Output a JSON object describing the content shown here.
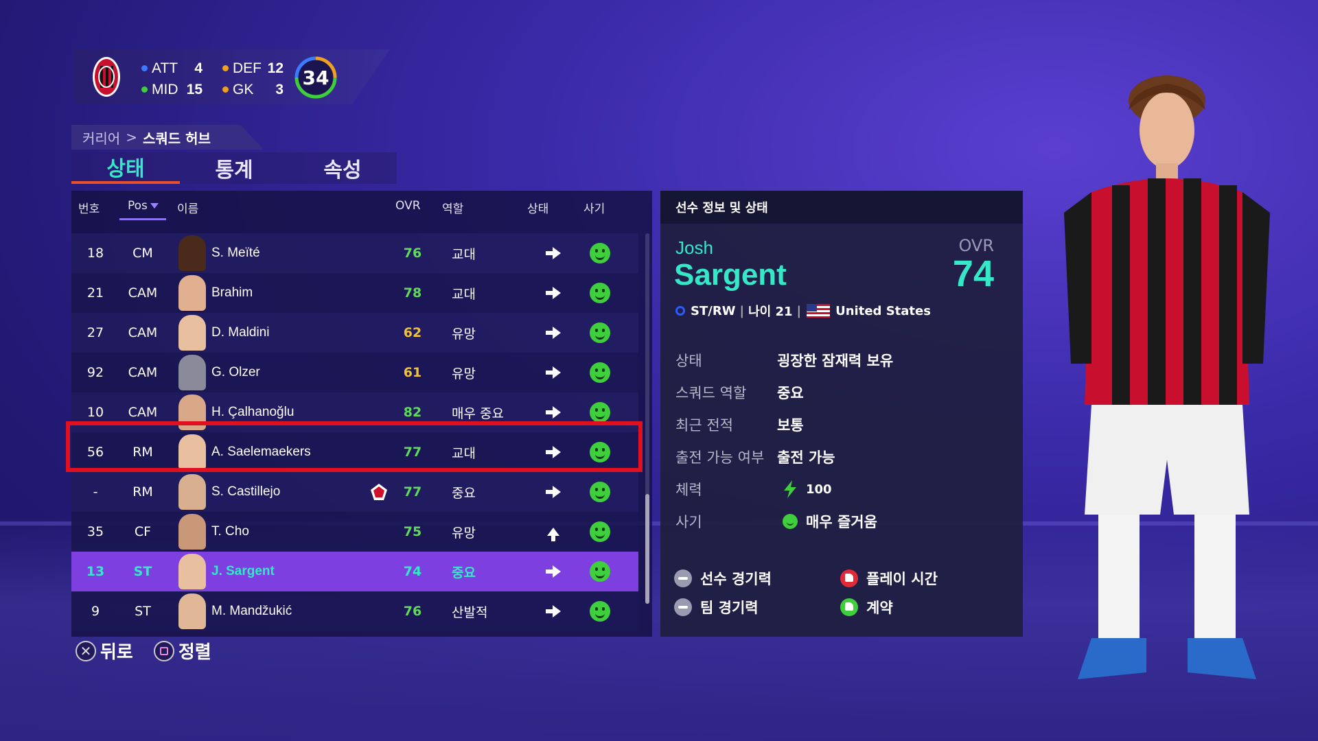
{
  "colors": {
    "accent": "#34e8c8",
    "selected_row": "#7d3fe0",
    "highlight": "#e0101e",
    "ovr_green": "#5fdc5a",
    "ovr_yellow": "#f0c23a"
  },
  "squad_summary": {
    "att_label": "ATT",
    "att_count": "4",
    "def_label": "DEF",
    "def_count": "12",
    "mid_label": "MID",
    "mid_count": "15",
    "gk_label": "GK",
    "gk_count": "3",
    "total": "34"
  },
  "breadcrumb": {
    "root": "커리어",
    "separator": ">",
    "current": "스쿼드 허브"
  },
  "tabs": [
    {
      "label": "상태",
      "active": true
    },
    {
      "label": "통계",
      "active": false
    },
    {
      "label": "속성",
      "active": false
    }
  ],
  "table": {
    "headers": {
      "number": "번호",
      "pos": "Pos",
      "name": "이름",
      "ovr": "OVR",
      "role": "역할",
      "status": "상태",
      "morale": "사기"
    },
    "rows": [
      {
        "number": "18",
        "pos": "CM",
        "name": "S. Meïté",
        "ovr": "76",
        "ovr_color": "green",
        "role": "교대",
        "status": "arrow-right-icon",
        "morale": "happy-face-icon"
      },
      {
        "number": "21",
        "pos": "CAM",
        "name": "Brahim",
        "ovr": "78",
        "ovr_color": "green",
        "role": "교대",
        "status": "arrow-right-icon",
        "morale": "happy-face-icon"
      },
      {
        "number": "27",
        "pos": "CAM",
        "name": "D. Maldini",
        "ovr": "62",
        "ovr_color": "yellow",
        "role": "유망",
        "status": "arrow-right-icon",
        "morale": "happy-face-icon"
      },
      {
        "number": "92",
        "pos": "CAM",
        "name": "G. Olzer",
        "ovr": "61",
        "ovr_color": "yellow",
        "role": "유망",
        "status": "arrow-right-icon",
        "morale": "happy-face-icon"
      },
      {
        "number": "10",
        "pos": "CAM",
        "name": "H. Çalhanoğlu",
        "ovr": "82",
        "ovr_color": "green",
        "role": "매우 중요",
        "status": "arrow-right-icon",
        "morale": "happy-face-icon"
      },
      {
        "number": "56",
        "pos": "RM",
        "name": "A. Saelemaekers",
        "ovr": "77",
        "ovr_color": "green",
        "role": "교대",
        "status": "arrow-right-icon",
        "morale": "happy-face-icon"
      },
      {
        "number": "-",
        "pos": "RM",
        "name": "S. Castillejo",
        "ovr": "77",
        "ovr_color": "green",
        "role": "중요",
        "status": "arrow-right-icon",
        "morale": "happy-face-icon",
        "loan_badge": "loan-club-badge-icon"
      },
      {
        "number": "35",
        "pos": "CF",
        "name": "T. Cho",
        "ovr": "75",
        "ovr_color": "green",
        "role": "유망",
        "status": "arrow-up-icon",
        "morale": "happy-face-icon"
      },
      {
        "number": "13",
        "pos": "ST",
        "name": "J. Sargent",
        "ovr": "74",
        "ovr_color": "green",
        "role": "중요",
        "status": "arrow-right-icon",
        "morale": "happy-face-icon",
        "selected": true
      },
      {
        "number": "9",
        "pos": "ST",
        "name": "M. Mandžukić",
        "ovr": "76",
        "ovr_color": "green",
        "role": "산발적",
        "status": "arrow-right-icon",
        "morale": "happy-face-icon"
      }
    ]
  },
  "hints": {
    "back_label": "뒤로",
    "sort_label": "정렬"
  },
  "player_info": {
    "header": "선수 정보 및 상태",
    "first_name": "Josh",
    "last_name": "Sargent",
    "ovr_label": "OVR",
    "ovr": "74",
    "positions": "ST/RW",
    "age": "나이 21",
    "nation": "United States",
    "details": [
      {
        "key": "상태",
        "value": "굉장한 잠재력 보유"
      },
      {
        "key": "스쿼드 역할",
        "value": "중요"
      },
      {
        "key": "최근 전적",
        "value": "보통"
      },
      {
        "key": "출전 가능 여부",
        "value": "출전 가능"
      },
      {
        "key": "체력",
        "value": "100"
      },
      {
        "key": "사기",
        "value": "매우 즐거움"
      }
    ],
    "factors": [
      {
        "label": "선수 경기력",
        "icon": "neutral-minus-icon"
      },
      {
        "label": "플레이 시간",
        "icon": "thumbs-down-icon"
      },
      {
        "label": "팀 경기력",
        "icon": "neutral-minus-icon"
      },
      {
        "label": "계약",
        "icon": "thumbs-up-icon"
      }
    ]
  }
}
